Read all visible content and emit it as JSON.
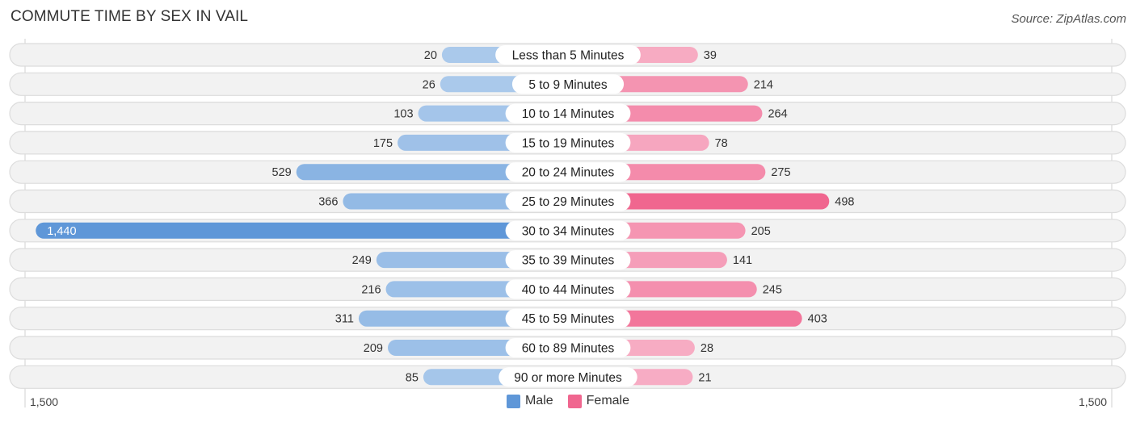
{
  "header": {
    "title": "COMMUTE TIME BY SEX IN VAIL",
    "source": "Source: ZipAtlas.com"
  },
  "colors": {
    "male_dark": "#5f97d8",
    "male_light": "#adcbec",
    "female_dark": "#f0668f",
    "female_light": "#f7aec5",
    "row_bg": "#f2f2f2",
    "row_border": "#dcdcdc"
  },
  "legend": {
    "male_label": "Male",
    "female_label": "Female",
    "male_color": "#5f97d8",
    "female_color": "#f0668f"
  },
  "chart_data": {
    "type": "bar",
    "orientation": "horizontal-diverging",
    "title": "COMMUTE TIME BY SEX IN VAIL",
    "categories": [
      "Less than 5 Minutes",
      "5 to 9 Minutes",
      "10 to 14 Minutes",
      "15 to 19 Minutes",
      "20 to 24 Minutes",
      "25 to 29 Minutes",
      "30 to 34 Minutes",
      "35 to 39 Minutes",
      "40 to 44 Minutes",
      "45 to 59 Minutes",
      "60 to 89 Minutes",
      "90 or more Minutes"
    ],
    "series": [
      {
        "name": "Male",
        "values": [
          20,
          26,
          103,
          175,
          529,
          366,
          1440,
          249,
          216,
          311,
          209,
          85
        ]
      },
      {
        "name": "Female",
        "values": [
          39,
          214,
          264,
          78,
          275,
          498,
          205,
          141,
          245,
          403,
          28,
          21
        ]
      }
    ],
    "value_labels": {
      "Male": [
        "20",
        "26",
        "103",
        "175",
        "529",
        "366",
        "1,440",
        "249",
        "216",
        "311",
        "209",
        "85"
      ],
      "Female": [
        "39",
        "214",
        "264",
        "78",
        "275",
        "498",
        "205",
        "141",
        "245",
        "403",
        "28",
        "21"
      ]
    },
    "xlim": [
      -1500,
      1500
    ],
    "axis_labels": {
      "left": "1,500",
      "right": "1,500"
    },
    "legend_position": "bottom-center",
    "grid": false
  }
}
